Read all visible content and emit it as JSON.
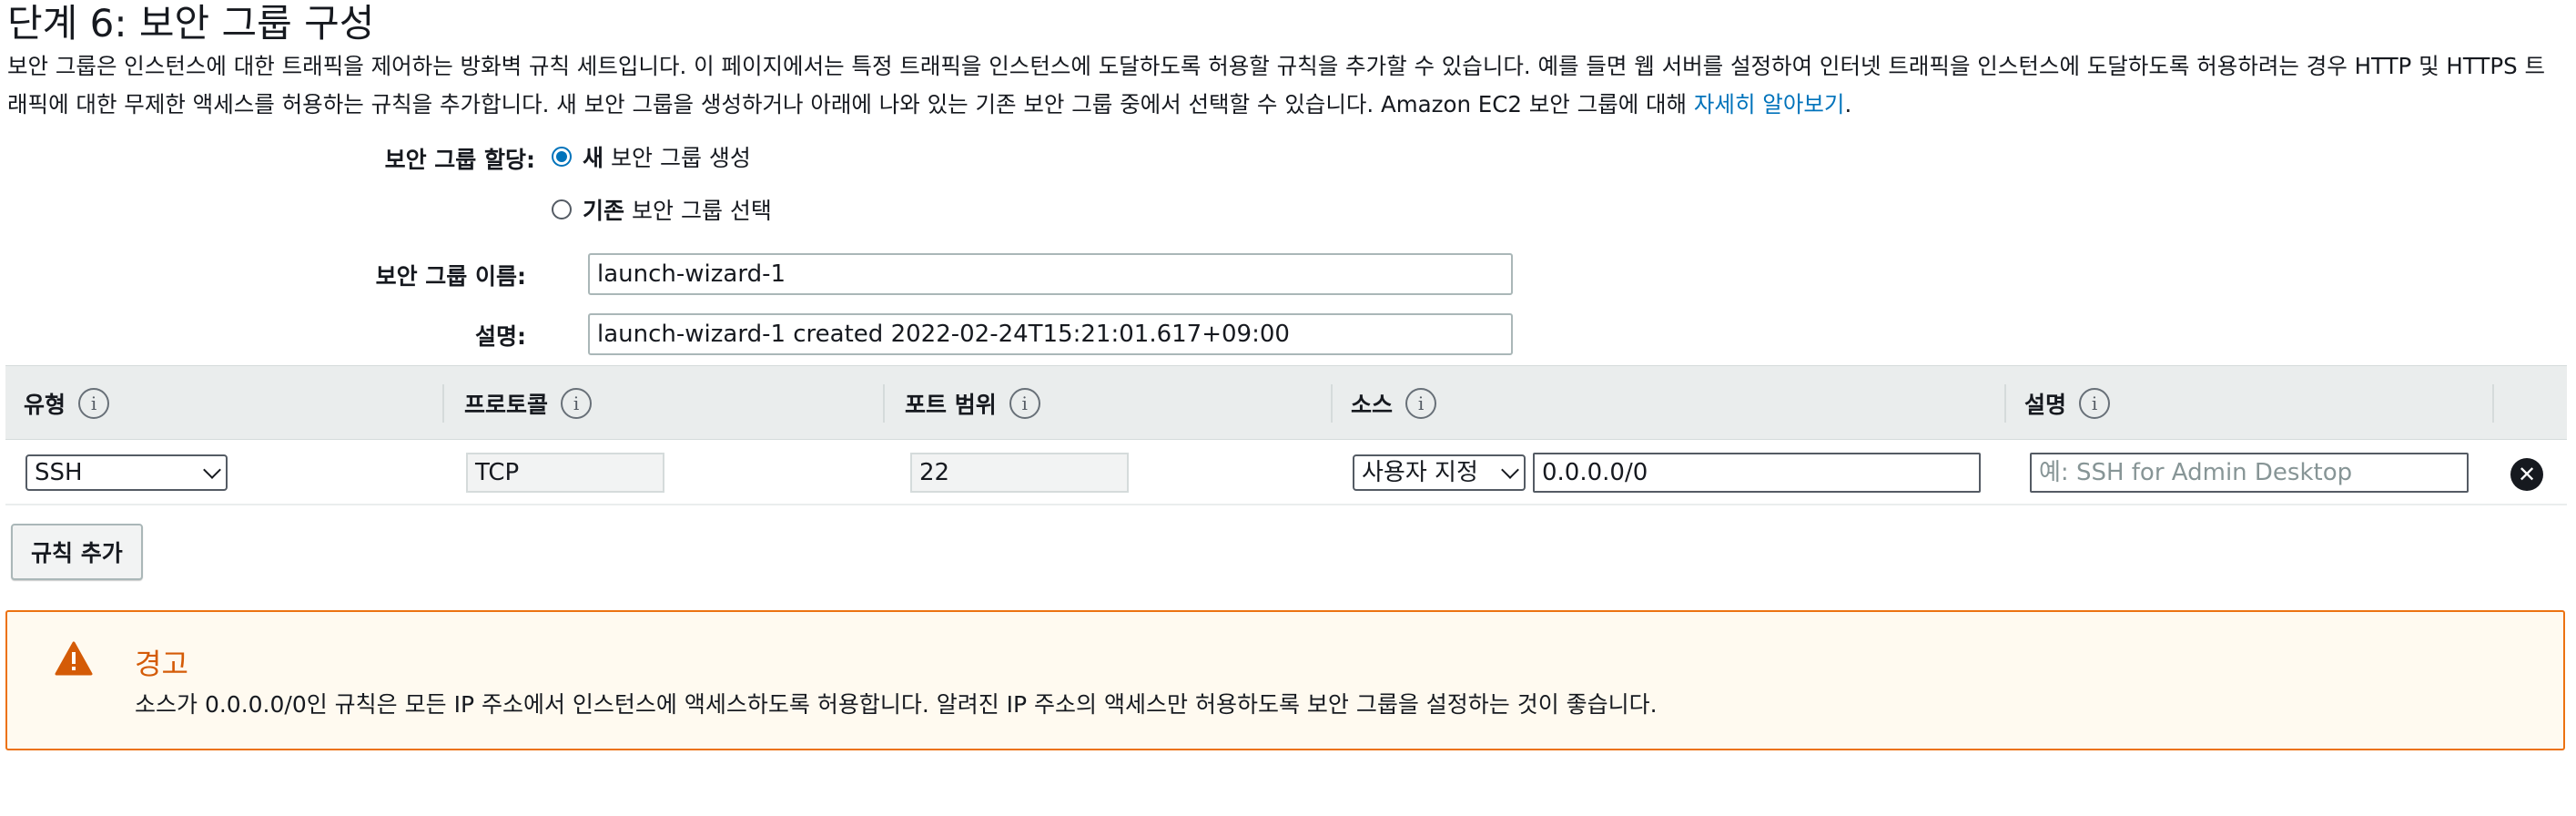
{
  "page": {
    "title": "단계 6: 보안 그룹 구성",
    "intro_text": "보안 그룹은 인스턴스에 대한 트래픽을 제어하는 방화벽 규칙 세트입니다. 이 페이지에서는 특정 트래픽을 인스턴스에 도달하도록 허용할 규칙을 추가할 수 있습니다. 예를 들면 웹 서버를 설정하여 인터넷 트래픽을 인스턴스에 도달하도록 허용하려는 경우 HTTP 및 HTTPS 트래픽에 대한 무제한 액세스를 허용하는 규칙을 추가합니다. 새 보안 그룹을 생성하거나 아래에 나와 있는 기존 보안 그룹 중에서 선택할 수 있습니다. Amazon EC2 보안 그룹에 대해 ",
    "intro_link": "자세히 알아보기",
    "intro_end": "."
  },
  "form": {
    "assign_label": "보안 그룹 할당:",
    "option_new_bold": "새",
    "option_new_rest": "보안 그룹 생성",
    "option_existing_bold": "기존",
    "option_existing_rest": "보안 그룹 선택",
    "name_label": "보안 그룹 이름:",
    "name_value": "launch-wizard-1",
    "desc_label": "설명:",
    "desc_value": "launch-wizard-1 created 2022-02-24T15:21:01.617+09:00"
  },
  "table": {
    "headers": [
      "유형",
      "프로토콜",
      "포트 범위",
      "소스",
      "설명"
    ],
    "info_symbol": "i",
    "row": {
      "type": "SSH",
      "protocol": "TCP",
      "port": "22",
      "source_type": "사용자 지정",
      "source_value": "0.0.0.0/0",
      "description_placeholder": "예: SSH for Admin Desktop",
      "remove_symbol": "✕"
    }
  },
  "add_rule_label": "규칙 추가",
  "warning": {
    "title": "경고",
    "text": "소스가 0.0.0.0/0인 규칙은 모든 IP 주소에서 인스턴스에 액세스하도록 허용합니다. 알려진 IP 주소의 액세스만 허용하도록 보안 그룹을 설정하는 것이 좋습니다.",
    "icon": "warning-triangle-icon",
    "color": "#ec7211"
  }
}
